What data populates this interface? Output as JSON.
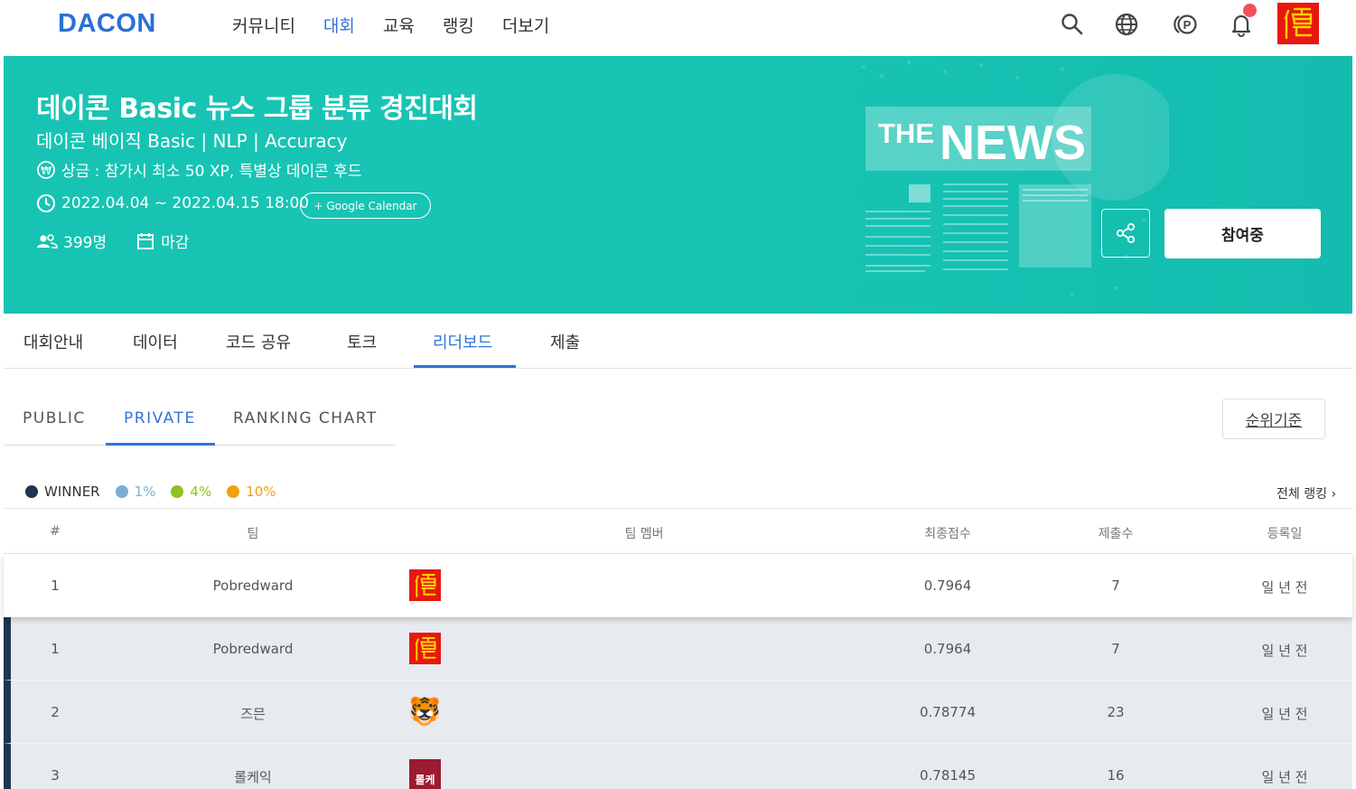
{
  "nav": {
    "logo": "DACON",
    "menu": [
      "커뮤니티",
      "대회",
      "교육",
      "랭킹",
      "더보기"
    ],
    "active_menu_index": 1
  },
  "icons": {
    "search": "search-icon",
    "globe": "globe-icon",
    "points": "points-icon",
    "bell": "bell-icon"
  },
  "banner": {
    "title": "데이콘 Basic 뉴스 그룹 분류 경진대회",
    "subtitle": "데이콘 베이직 Basic | NLP | Accuracy",
    "prize": "상금 : 참가시 최소 50 XP, 특별상 데이콘 후드",
    "period": "2022.04.04 ~ 2022.04.15 18:00",
    "gcal": "+ Google Calendar",
    "participants": "399명",
    "status": "마감",
    "graphic_text_the": "THE",
    "graphic_text_news": "NEWS",
    "join_label": "참여중",
    "bg_color": "#17c4b3"
  },
  "tabs": [
    "대회안내",
    "데이터",
    "코드 공유",
    "토크",
    "리더보드",
    "제출"
  ],
  "active_tab_index": 4,
  "subtabs": [
    "PUBLIC",
    "PRIVATE",
    "RANKING CHART"
  ],
  "active_subtab_index": 1,
  "criteria_label": "순위기준",
  "legend": [
    {
      "label": "WINNER",
      "color": "#1f3550"
    },
    {
      "label": "1%",
      "color": "#7aaed3"
    },
    {
      "label": "4%",
      "color": "#8dc21f"
    },
    {
      "label": "10%",
      "color": "#f0a20b"
    }
  ],
  "all_ranking": "전체 랭킹",
  "table": {
    "headers": [
      "#",
      "팀",
      "팀 멤버",
      "최종점수",
      "제출수",
      "등록일"
    ],
    "my_row": {
      "rank": "1",
      "team": "Pobredward",
      "avatar": "seal-avatar",
      "score": "0.7964",
      "submissions": "7",
      "date": "일 년 전"
    },
    "rows": [
      {
        "rank": "1",
        "team": "Pobredward",
        "avatar": "seal-avatar",
        "score": "0.7964",
        "submissions": "7",
        "date": "일 년 전"
      },
      {
        "rank": "2",
        "team": "즈믄",
        "avatar": "tiger-avatar",
        "avatar_glyph": "🐯",
        "score": "0.78774",
        "submissions": "23",
        "date": "일 년 전"
      },
      {
        "rank": "3",
        "team": "롤케익",
        "avatar": "text-avatar",
        "avatar_text": "롤케",
        "score": "0.78145",
        "submissions": "16",
        "date": "일 년 전"
      }
    ]
  }
}
